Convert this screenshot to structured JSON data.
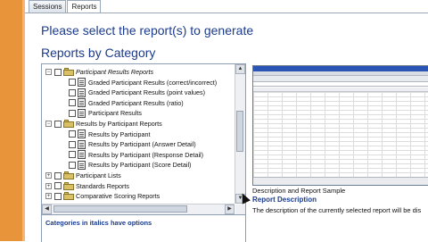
{
  "tabs": [
    {
      "label": "Sessions",
      "active": false
    },
    {
      "label": "Reports",
      "active": true
    }
  ],
  "heading": "Please select the report(s) to generate",
  "subheading": "Reports by Category",
  "tree": {
    "rows": [
      {
        "label": "Participant Results Reports",
        "italic": true,
        "kind": "folder",
        "expander": "−"
      },
      {
        "label": "Graded Participant Results (correct/incorrect)",
        "kind": "report"
      },
      {
        "label": "Graded Participant Results (point values)",
        "kind": "report"
      },
      {
        "label": "Graded Participant Results (ratio)",
        "kind": "report"
      },
      {
        "label": "Participant Results",
        "kind": "report"
      },
      {
        "label": "Results by Participant Reports",
        "italic": false,
        "kind": "folder",
        "expander": "−"
      },
      {
        "label": "Results by Participant",
        "kind": "report"
      },
      {
        "label": "Results by Participant (Answer Detail)",
        "kind": "report"
      },
      {
        "label": "Results by Participant (Response Detail)",
        "kind": "report"
      },
      {
        "label": "Results by Participant (Score Detail)",
        "kind": "report"
      },
      {
        "label": "Participant Lists",
        "italic": false,
        "kind": "folder",
        "expander": "+"
      },
      {
        "label": "Standards Reports",
        "italic": false,
        "kind": "folder",
        "expander": "+"
      },
      {
        "label": "Comparative Scoring Reports",
        "italic": false,
        "kind": "folder",
        "expander": "+"
      }
    ]
  },
  "hint": "Categories in italics have options",
  "description": {
    "label": "Description and Report Sample",
    "title": "Report Description",
    "text": "The description of the currently selected report will be dis"
  },
  "colors": {
    "accent_bar": "#e8943a",
    "heading": "#1b3b8c"
  }
}
